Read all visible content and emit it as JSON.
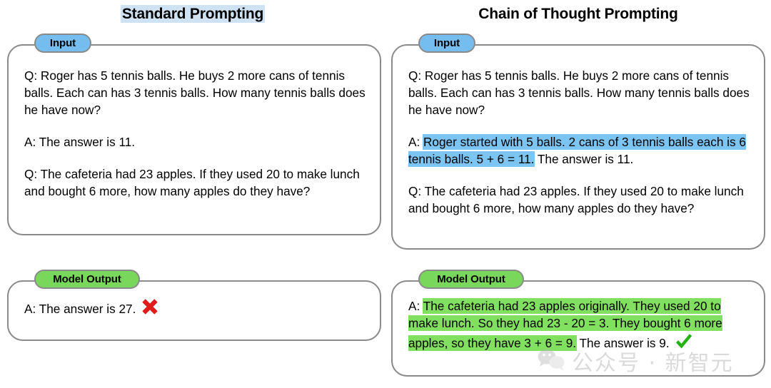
{
  "columns": {
    "left": {
      "title": "Standard Prompting",
      "title_highlighted": true,
      "input": {
        "badge": "Input",
        "paragraphs": [
          "Q: Roger has 5 tennis balls. He buys 2 more cans of tennis balls. Each can has 3 tennis balls. How many tennis balls does he have now?",
          "A: The answer is 11.",
          "Q: The cafeteria had 23 apples. If they used 20 to make lunch and bought 6 more, how many apples do they have?"
        ]
      },
      "output": {
        "badge": "Model Output",
        "prefix": "A: The answer is 27.",
        "mark": "cross-mark-icon"
      }
    },
    "right": {
      "title": "Chain of Thought Prompting",
      "title_highlighted": false,
      "input": {
        "badge": "Input",
        "q1": "Q: Roger has 5 tennis balls. He buys 2 more cans of tennis balls. Each can has 3 tennis balls. How many tennis balls does he have now?",
        "a1_prefix": "A: ",
        "a1_highlighted": "Roger started with 5 balls. 2 cans of 3 tennis balls each is 6 tennis balls. 5 + 6 = 11.",
        "a1_suffix": " The answer is 11.",
        "q2": "Q: The cafeteria had 23 apples. If they used 20 to make lunch and bought 6 more, how many apples do they have?"
      },
      "output": {
        "badge": "Model Output",
        "a_prefix": "A: ",
        "a_highlighted": "The cafeteria had 23 apples originally. They used 20 to make lunch. So they had 23 - 20 = 3. They bought 6 more apples, so they have 3 + 6 = 9.",
        "a_suffix": " The answer is 9.",
        "mark": "check-mark-icon"
      }
    }
  },
  "watermark": {
    "icon": "wechat-icon",
    "text": "公众号 · 新智元"
  },
  "colors": {
    "title_highlight": "#cfe2f3",
    "blue_highlight": "#7cc4f2",
    "green_highlight": "#82e060",
    "badge_blue": "#74bdee",
    "badge_green": "#79d85c",
    "border_gray": "#8a8a8a",
    "cross_red": "#e01b1b",
    "check_green": "#22b214"
  }
}
